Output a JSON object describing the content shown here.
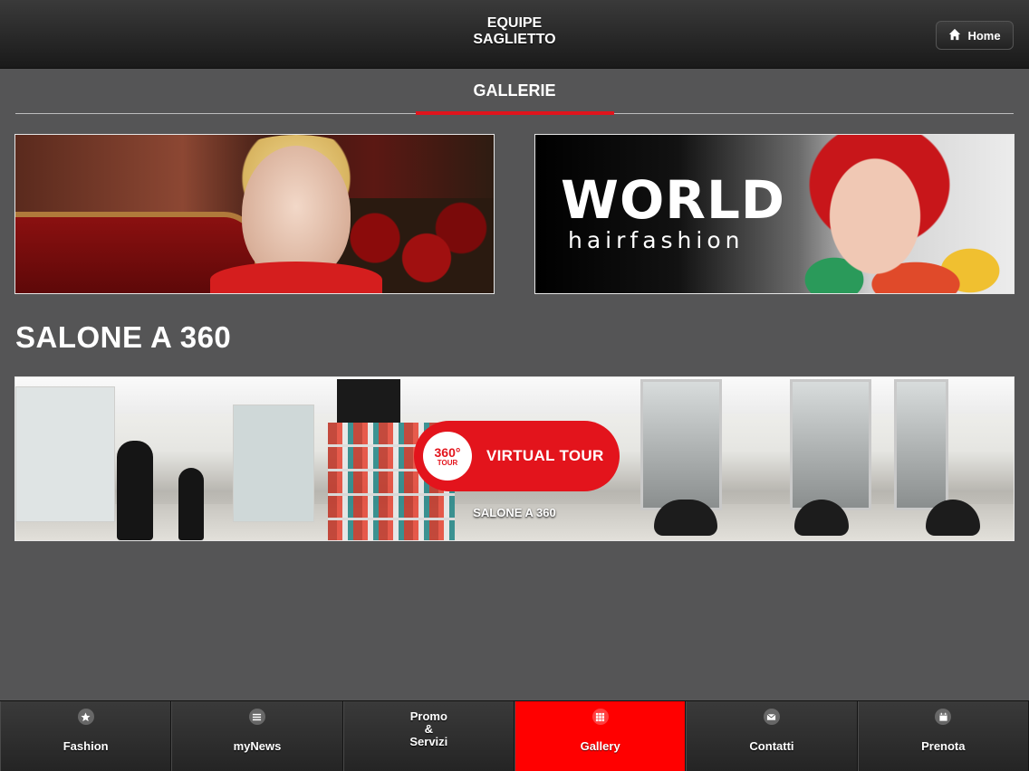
{
  "header": {
    "title_line1": "EQUIPE",
    "title_line2": "SAGLIETTO",
    "home_label": "Home"
  },
  "section": {
    "title": "GALLERIE"
  },
  "colors": {
    "accent": "#e0141c",
    "background": "#555556",
    "header": "#1f1f1f",
    "nav_active": "#ff0000"
  },
  "banners": {
    "right_brand": "WORLD",
    "right_sub": "hairfashion"
  },
  "salone": {
    "heading": "SALONE A 360",
    "badge_number": "360°",
    "badge_text": "TOUR",
    "virtual_tour_label": "VIRTUAL TOUR",
    "caption": "SALONE A 360"
  },
  "nav": {
    "items": [
      {
        "label": "Fashion",
        "icon": "star-icon"
      },
      {
        "label": "myNews",
        "icon": "list-icon"
      },
      {
        "label_line1": "Promo",
        "label_line2": "&",
        "label_line3": "Servizi"
      },
      {
        "label": "Gallery",
        "icon": "grid-icon",
        "active": true
      },
      {
        "label": "Contatti",
        "icon": "mail-icon"
      },
      {
        "label": "Prenota",
        "icon": "calendar-icon"
      }
    ]
  }
}
